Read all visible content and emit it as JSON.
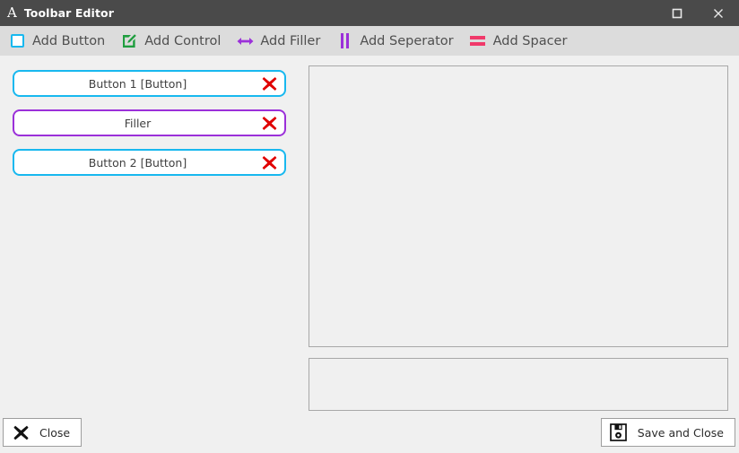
{
  "titlebar": {
    "logo": "A",
    "title": "Toolbar Editor",
    "maximize_icon": "maximize-icon",
    "close_icon": "close-icon"
  },
  "toolbar": {
    "items": [
      {
        "label": "Add Button",
        "icon": "square-outline-icon",
        "color": "#18b8ef"
      },
      {
        "label": "Add Control",
        "icon": "pencil-square-icon",
        "color": "#1f9e3f"
      },
      {
        "label": "Add Filler",
        "icon": "double-arrow-horizontal-icon",
        "color": "#9b30d9"
      },
      {
        "label": "Add Seperator",
        "icon": "vertical-bars-icon",
        "color": "#9b30d9"
      },
      {
        "label": "Add Spacer",
        "icon": "horizontal-bars-icon",
        "color": "#f0396a"
      }
    ]
  },
  "item_list": [
    {
      "label": "Button 1 [Button]",
      "type": "button",
      "accent": "#18b8ef",
      "delete_icon": "delete-x-icon"
    },
    {
      "label": "Filler",
      "type": "filler",
      "accent": "#9b30d9",
      "delete_icon": "delete-x-icon"
    },
    {
      "label": "Button 2 [Button]",
      "type": "button",
      "accent": "#18b8ef",
      "delete_icon": "delete-x-icon"
    }
  ],
  "panels": {
    "preview": {
      "content": ""
    },
    "properties": {
      "content": ""
    }
  },
  "footer": {
    "close": {
      "label": "Close",
      "icon": "x-icon"
    },
    "save": {
      "label": "Save and Close",
      "icon": "floppy-disk-icon"
    }
  },
  "colors": {
    "titlebar_bg": "#4a4a4a",
    "toolbar_bg": "#dcdcdc",
    "body_bg": "#f0f0f0",
    "panel_border": "#a8a8a8",
    "button_accent": "#18b8ef",
    "filler_accent": "#9b30d9",
    "spacer_accent": "#f0396a",
    "control_accent": "#1f9e3f",
    "delete_red": "#e00000"
  }
}
